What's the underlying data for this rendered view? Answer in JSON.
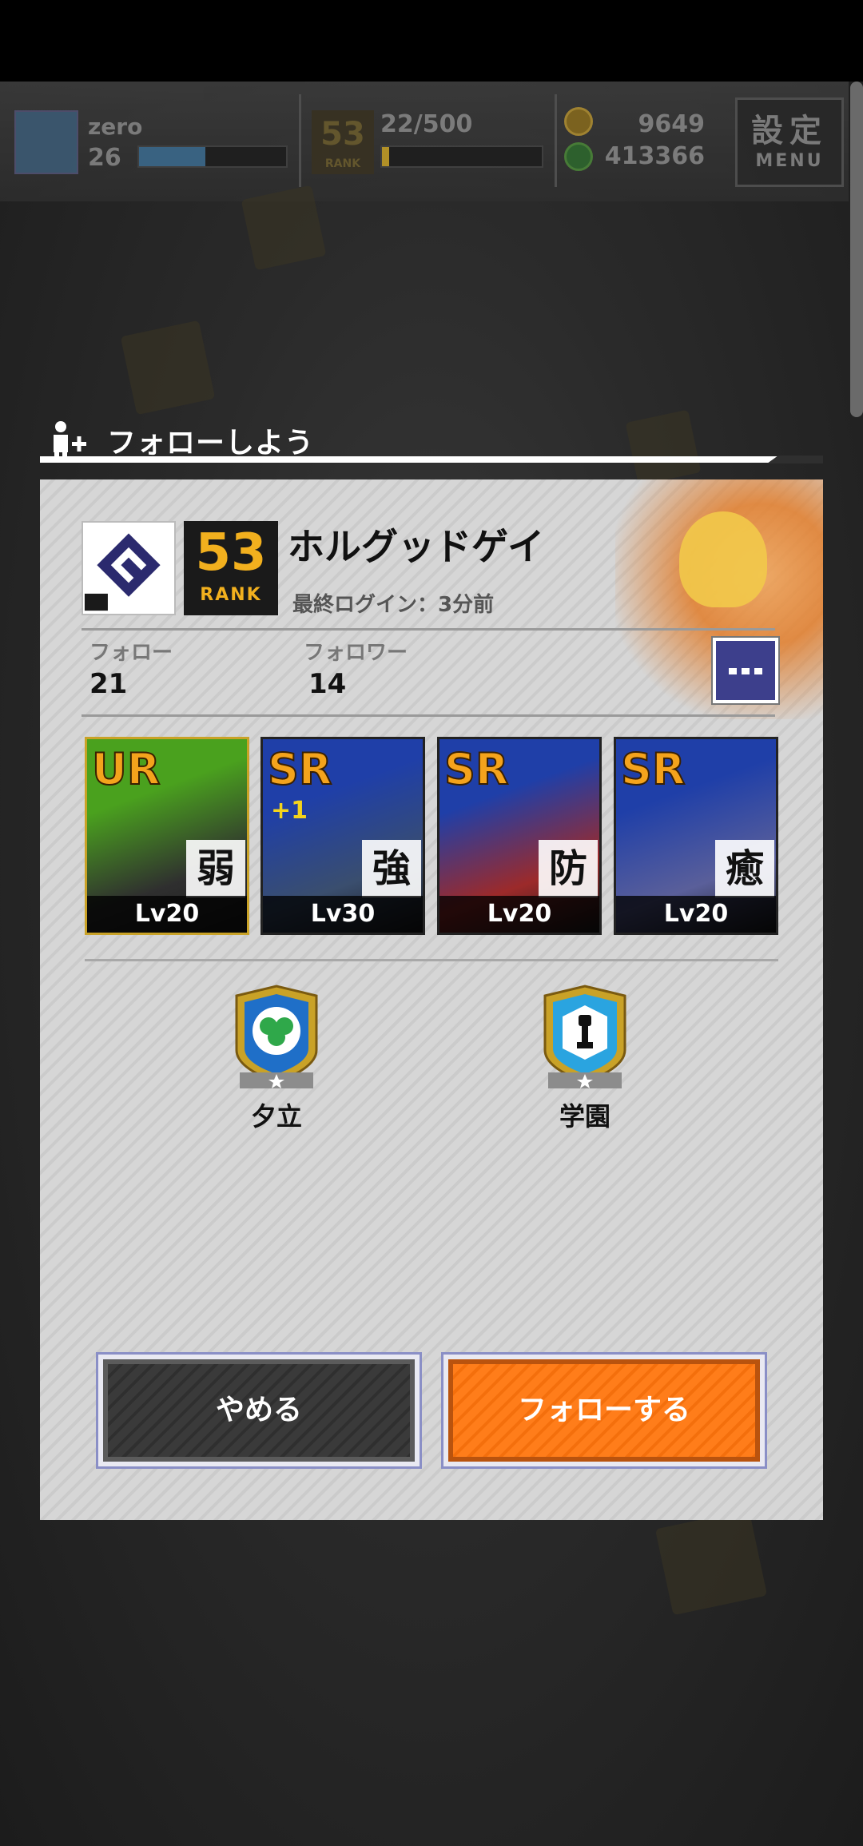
{
  "hud": {
    "player_name": "zero",
    "player_level": "26",
    "exp_progress": 0.45,
    "rank_number": "53",
    "rank_word": "RANK",
    "stamina": "22/500",
    "stamina_progress": 0.044,
    "gold": "9649",
    "green_currency": "413366",
    "menu_kanji": "設定",
    "menu_label": "MENU"
  },
  "dialog": {
    "title": "フォローしよう",
    "profile": {
      "name": "ホルグッドゲイ",
      "rank_number": "53",
      "rank_word": "RANK",
      "last_login": "最終ログイン：3分前",
      "follow_label": "フォロー",
      "follow_count": "21",
      "follower_label": "フォロワー",
      "follower_count": "14"
    },
    "cards": [
      {
        "rarity": "UR",
        "plus": "",
        "attribute": "弱",
        "level": "Lv20",
        "colors": [
          "#4aa11e",
          "#2f2f2f"
        ]
      },
      {
        "rarity": "SR",
        "plus": "+1",
        "attribute": "強",
        "level": "Lv30",
        "colors": [
          "#1f3fa8",
          "#3a4e6e"
        ]
      },
      {
        "rarity": "SR",
        "plus": "",
        "attribute": "防",
        "level": "Lv20",
        "colors": [
          "#1f3fa8",
          "#9c2a2a"
        ]
      },
      {
        "rarity": "SR",
        "plus": "",
        "attribute": "癒",
        "level": "Lv20",
        "colors": [
          "#1f3fa8",
          "#5a5f9a"
        ]
      }
    ],
    "emblems": [
      {
        "label": "夕立",
        "color": "#1f6fc8",
        "icon": "clover-icon"
      },
      {
        "label": "学園",
        "color": "#2aa4e0",
        "icon": "tower-icon"
      }
    ],
    "buttons": {
      "cancel": "やめる",
      "follow": "フォローする"
    }
  }
}
